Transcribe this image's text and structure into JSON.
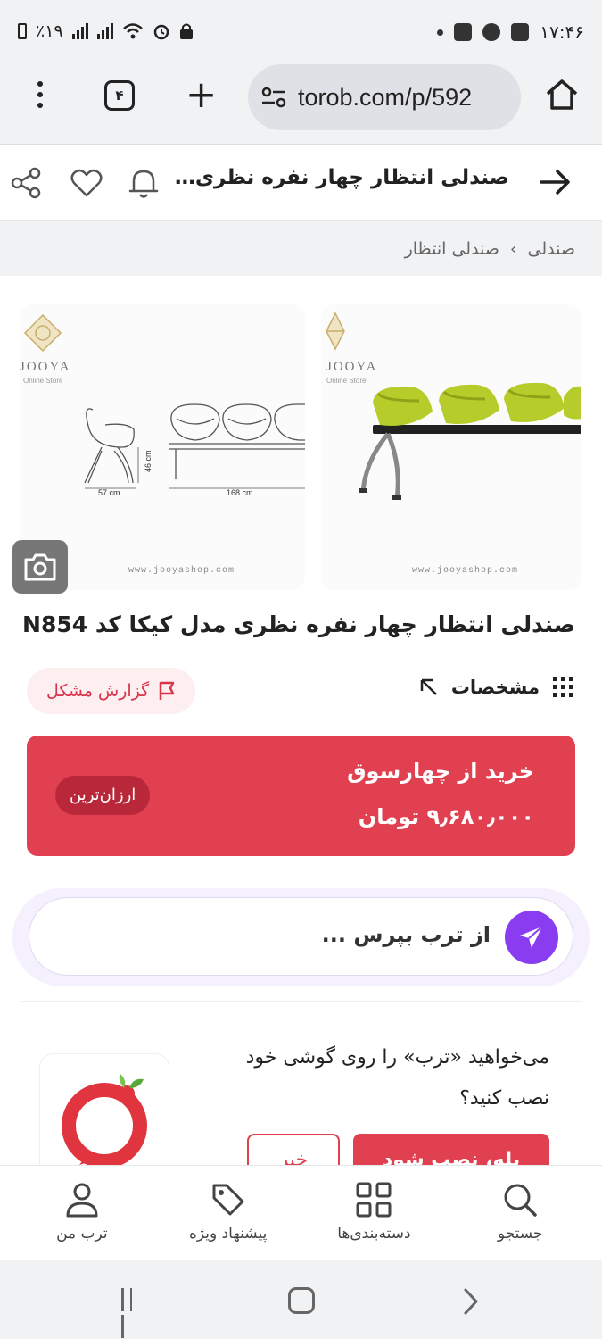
{
  "status_bar": {
    "time": "۱۷:۴۶",
    "battery": "٪۱۹"
  },
  "browser": {
    "tab_count": "۴",
    "url": "torob.com/p/592"
  },
  "header": {
    "title": "صندلی انتظار چهار نفره نظری مد..."
  },
  "breadcrumb": {
    "items": [
      "صندلی",
      "صندلی انتظار"
    ],
    "separator": "›"
  },
  "gallery": {
    "brand_text": "JOOYA",
    "brand_sub": "Online Store",
    "watermark": "www.jooyashop.com",
    "dim_width": "57 cm",
    "dim_height": "46 cm",
    "dim_length": "168 cm"
  },
  "product": {
    "title": "صندلی انتظار چهار نفره نظری مدل کیکا کد N854"
  },
  "actions": {
    "specs_label": "مشخصات",
    "report_label": "گزارش مشکل"
  },
  "buy": {
    "label": "خرید از چهارسوق",
    "price": "۹٫۶۸۰٫۰۰۰ تومان",
    "badge": "ارزان‌ترین"
  },
  "ask": {
    "placeholder": "از ترب بپرس ..."
  },
  "install": {
    "question": "می‌خواهید «ترب» را روی گوشی خود نصب کنید؟",
    "yes_label": "بله، نصب شود",
    "no_label": "خیر"
  },
  "bottom_nav": {
    "items": [
      {
        "label": "جستجو",
        "icon": "search-icon"
      },
      {
        "label": "دسته‌بندی‌ها",
        "icon": "grid-icon"
      },
      {
        "label": "پیشنهاد ویژه",
        "icon": "tag-icon"
      },
      {
        "label": "ترب من",
        "icon": "user-icon"
      }
    ]
  },
  "colors": {
    "primary": "#e0404f",
    "accent": "#8a3df0",
    "chair_green": "#b5cc2a"
  }
}
